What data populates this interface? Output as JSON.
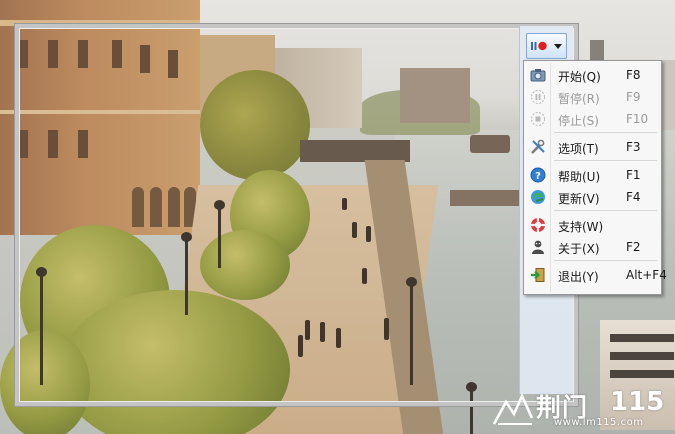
{
  "menu": {
    "items": [
      {
        "label": "开始(Q)",
        "shortcut": "F8",
        "icon": "camera-icon",
        "enabled": true
      },
      {
        "label": "暂停(R)",
        "shortcut": "F9",
        "icon": "pause-icon",
        "enabled": false
      },
      {
        "label": "停止(S)",
        "shortcut": "F10",
        "icon": "stop-icon",
        "enabled": false
      },
      {
        "label": "选项(T)",
        "shortcut": "F3",
        "icon": "tools-icon",
        "enabled": true
      },
      {
        "label": "帮助(U)",
        "shortcut": "F1",
        "icon": "help-icon",
        "enabled": true
      },
      {
        "label": "更新(V)",
        "shortcut": "F4",
        "icon": "update-icon",
        "enabled": true
      },
      {
        "label": "支持(W)",
        "shortcut": "",
        "icon": "support-icon",
        "enabled": true
      },
      {
        "label": "关于(X)",
        "shortcut": "F2",
        "icon": "about-icon",
        "enabled": true
      },
      {
        "label": "退出(Y)",
        "shortcut": "Alt+F4",
        "icon": "exit-icon",
        "enabled": true
      }
    ]
  },
  "toolbar": {
    "record_icon": "record-icon",
    "dropdown_icon": "chevron-down-icon"
  },
  "watermark": {
    "text_cn": "荆门",
    "text_num": "115",
    "url": "www.lm115.com"
  },
  "colors": {
    "frame": "#c4c4c4",
    "record_red": "#e02020",
    "menu_bg": "#f7f7f7",
    "disabled_text": "#9a9a9a"
  }
}
